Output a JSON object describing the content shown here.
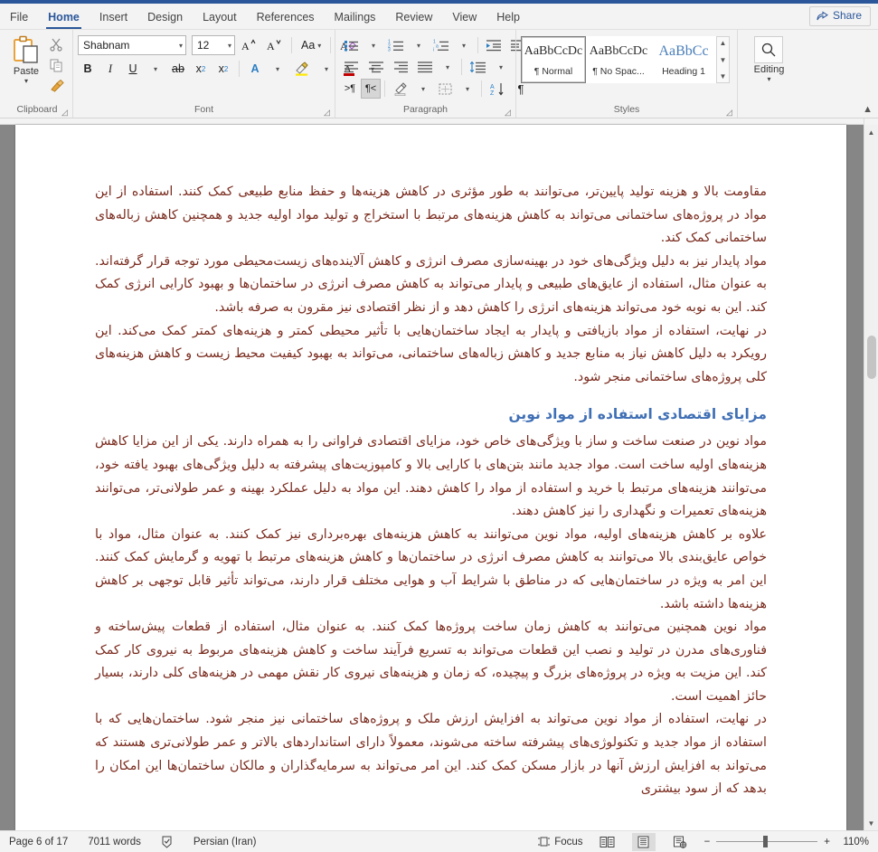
{
  "window": {
    "share_label": "Share"
  },
  "tabs": [
    {
      "label": "File",
      "active": false
    },
    {
      "label": "Home",
      "active": true
    },
    {
      "label": "Insert",
      "active": false
    },
    {
      "label": "Design",
      "active": false
    },
    {
      "label": "Layout",
      "active": false
    },
    {
      "label": "References",
      "active": false
    },
    {
      "label": "Mailings",
      "active": false
    },
    {
      "label": "Review",
      "active": false
    },
    {
      "label": "View",
      "active": false
    },
    {
      "label": "Help",
      "active": false
    }
  ],
  "ribbon": {
    "clipboard": {
      "group_label": "Clipboard",
      "paste_label": "Paste",
      "cut_icon": "scissors-icon",
      "copy_icon": "copy-icon",
      "format_painter_icon": "format-painter-icon"
    },
    "font": {
      "group_label": "Font",
      "font_name": "Shabnam",
      "font_size": "12",
      "bold_label": "B",
      "italic_label": "I",
      "underline_label": "U",
      "strikethrough_label": "ab",
      "subscript_label": "x",
      "superscript_label": "x",
      "grow_font_icon": "grow-font-icon",
      "shrink_font_icon": "shrink-font-icon",
      "change_case_label": "Aa",
      "clear_formatting_icon": "clear-formatting-icon",
      "text_effects_label": "A",
      "highlight_label": "A",
      "font_color_label": "A"
    },
    "paragraph": {
      "group_label": "Paragraph",
      "bullets_icon": "bullet-list-icon",
      "numbering_icon": "numbered-list-icon",
      "multilevel_icon": "multilevel-list-icon",
      "decrease_indent_icon": "decrease-indent-icon",
      "increase_indent_icon": "increase-indent-icon",
      "align_left_icon": "align-left-icon",
      "align_center_icon": "align-center-icon",
      "align_right_icon": "align-right-icon",
      "justify_icon": "justify-icon",
      "line_spacing_icon": "line-spacing-icon",
      "ltr_label": ">¶",
      "rtl_label": "¶<",
      "shading_icon": "shading-icon",
      "borders_icon": "borders-icon",
      "sort_label": "A\nZ",
      "show_marks_label": "¶"
    },
    "styles": {
      "group_label": "Styles",
      "items": [
        {
          "preview": "AaBbCcDc",
          "name": "¶ Normal",
          "selected": true
        },
        {
          "preview": "AaBbCcDc",
          "name": "¶ No Spac...",
          "selected": false
        },
        {
          "preview": "AaBbCc",
          "name": "Heading 1",
          "selected": false
        }
      ]
    },
    "editing": {
      "group_label": "Editing",
      "button_label": "Editing",
      "icon": "magnifier-icon"
    }
  },
  "document": {
    "paragraphs": [
      {
        "type": "body",
        "text": "مقاومت بالا و هزینه تولید پایین‌تر، می‌توانند به طور مؤثری در کاهش هزینه‌ها و حفظ منابع طبیعی کمک کنند. استفاده از این مواد در پروژه‌های ساختمانی می‌تواند به کاهش هزینه‌های مرتبط با استخراج و تولید مواد اولیه جدید و همچنین کاهش زباله‌های ساختمانی کمک کند."
      },
      {
        "type": "body",
        "text": "مواد پایدار نیز به دلیل ویژگی‌های خود در بهینه‌سازی مصرف انرژی و کاهش آلاینده‌های زیست‌محیطی مورد توجه قرار گرفته‌اند. به عنوان مثال، استفاده از عایق‌های طبیعی و پایدار می‌تواند به کاهش مصرف انرژی در ساختمان‌ها و بهبود کارایی انرژی کمک کند. این به نوبه خود می‌تواند هزینه‌های انرژی را کاهش دهد و از نظر اقتصادی نیز مقرون به صرفه باشد."
      },
      {
        "type": "body",
        "text": "در نهایت، استفاده از مواد بازیافتی و پایدار به ایجاد ساختمان‌هایی با تأثیر محیطی کمتر و هزینه‌های کمتر کمک می‌کند. این رویکرد به دلیل کاهش نیاز به منابع جدید و کاهش زباله‌های ساختمانی، می‌تواند به بهبود کیفیت محیط زیست و کاهش هزینه‌های کلی پروژه‌های ساختمانی منجر شود."
      },
      {
        "type": "heading",
        "text": "مزایای اقتصادی استفاده از مواد نوین"
      },
      {
        "type": "body",
        "text": "مواد نوین در صنعت ساخت و ساز با ویژگی‌های خاص خود، مزایای اقتصادی فراوانی را به همراه دارند. یکی از این مزایا کاهش هزینه‌های اولیه ساخت است. مواد جدید مانند بتن‌های با کارایی بالا و کامپوزیت‌های پیشرفته به دلیل ویژگی‌های بهبود یافته خود، می‌توانند هزینه‌های مرتبط با خرید و استفاده از مواد را کاهش دهند. این مواد به دلیل عملکرد بهینه و عمر طولانی‌تر، می‌توانند هزینه‌های تعمیرات و نگهداری را نیز کاهش دهند."
      },
      {
        "type": "body",
        "text": "علاوه بر کاهش هزینه‌های اولیه، مواد نوین می‌توانند به کاهش هزینه‌های بهره‌برداری نیز کمک کنند. به عنوان مثال، مواد با خواص عایق‌بندی بالا می‌توانند به کاهش مصرف انرژی در ساختمان‌ها و کاهش هزینه‌های مرتبط با تهویه و گرمایش کمک کنند. این امر به ویژه در ساختمان‌هایی که در مناطق با شرایط آب و هوایی مختلف قرار دارند، می‌تواند تأثیر قابل توجهی بر کاهش هزینه‌ها داشته باشد."
      },
      {
        "type": "body",
        "text": "مواد نوین همچنین می‌توانند به کاهش زمان ساخت پروژه‌ها کمک کنند. به عنوان مثال، استفاده از قطعات پیش‌ساخته و فناوری‌های مدرن در تولید و نصب این قطعات می‌تواند به تسریع فرآیند ساخت و کاهش هزینه‌های مربوط به نیروی کار کمک کند. این مزیت به ویژه در پروژه‌های بزرگ و پیچیده، که زمان و هزینه‌های نیروی کار نقش مهمی در هزینه‌های کلی دارند، بسیار حائز اهمیت است."
      },
      {
        "type": "body",
        "text": "در نهایت، استفاده از مواد نوین می‌تواند به افزایش ارزش ملک و پروژه‌های ساختمانی نیز منجر شود. ساختمان‌هایی که با استفاده از مواد جدید و تکنولوژی‌های پیشرفته ساخته می‌شوند، معمولاً دارای استانداردهای بالاتر و عمر طولانی‌تری هستند که می‌تواند به افزایش ارزش آنها در بازار مسکن کمک کند. این امر می‌تواند به سرمایه‌گذاران و مالکان ساختمان‌ها این امکان را بدهد که از سود بیشتری"
      }
    ]
  },
  "status_bar": {
    "page_info": "Page 6 of 17",
    "word_count": "7011 words",
    "proofing_icon": "proofing-check-icon",
    "language": "Persian (Iran)",
    "focus_label": "Focus",
    "read_mode_icon": "read-mode-icon",
    "print_layout_icon": "print-layout-icon",
    "web_layout_icon": "web-layout-icon",
    "zoom_out_label": "−",
    "zoom_in_label": "+",
    "zoom_level": "110%"
  },
  "colors": {
    "accent": "#2b579a",
    "body_text": "#7a2b1e",
    "heading_text": "#3f6fb5",
    "ribbon_bg": "#f3f3f3",
    "doc_bg": "#868686"
  }
}
